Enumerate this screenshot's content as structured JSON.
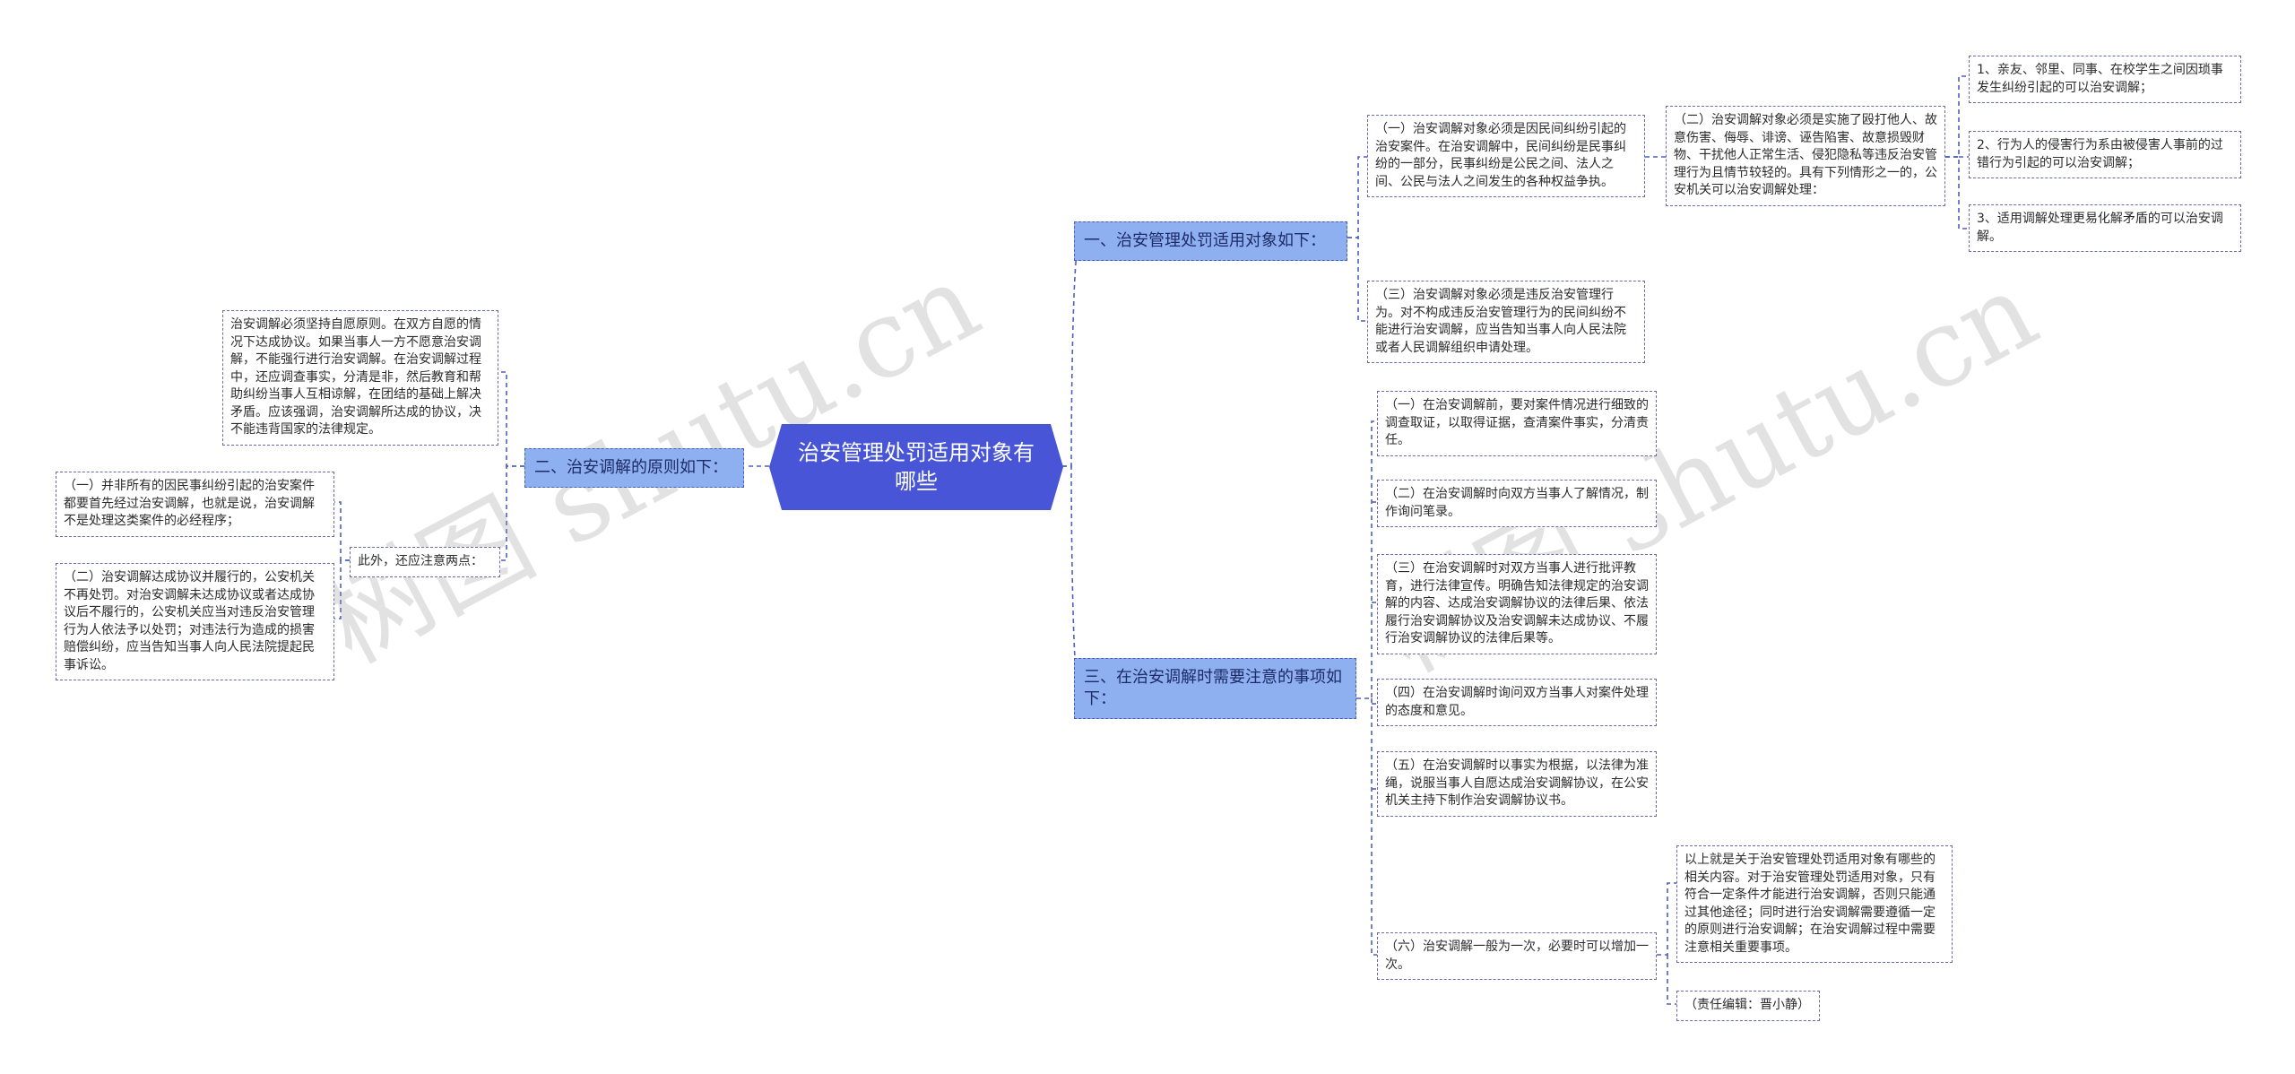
{
  "root": {
    "title": "治安管理处罚适用对象有哪些"
  },
  "branches": {
    "b1": "一、治安管理处罚适用对象如下：",
    "b2": "二、治安调解的原则如下：",
    "b3": "三、在治安调解时需要注意的事项如下："
  },
  "b1_children": {
    "c1": "（一）治安调解对象必须是因民间纠纷引起的治安案件。在治安调解中，民间纠纷是民事纠纷的一部分，民事纠纷是公民之间、法人之间、公民与法人之间发生的各种权益争执。",
    "c2": "（二）治安调解对象必须是实施了殴打他人、故意伤害、侮辱、诽谤、诬告陷害、故意损毁财物、干扰他人正常生活、侵犯隐私等违反治安管理行为且情节较轻的。具有下列情形之一的，公安机关可以治安调解处理：",
    "c3": "（三）治安调解对象必须是违反治安管理行为。对不构成违反治安管理行为的民间纠纷不能进行治安调解，应当告知当事人向人民法院或者人民调解组织申请处理。",
    "d1": "1、亲友、邻里、同事、在校学生之间因琐事发生纠纷引起的可以治安调解；",
    "d2": "2、行为人的侵害行为系由被侵害人事前的过错行为引起的可以治安调解；",
    "d3": "3、适用调解处理更易化解矛盾的可以治安调解。"
  },
  "b2_children": {
    "main": "治安调解必须坚持自愿原则。在双方自愿的情况下达成协议。如果当事人一方不愿意治安调解，不能强行进行治安调解。在治安调解过程中，还应调查事实，分清是非，然后教育和帮助纠纷当事人互相谅解，在团结的基础上解决矛盾。应该强调，治安调解所达成的协议，决不能违背国家的法律规定。",
    "extra": "此外，还应注意两点：",
    "p1": "（一）并非所有的因民事纠纷引起的治安案件都要首先经过治安调解，也就是说，治安调解不是处理这类案件的必经程序；",
    "p2": "（二）治安调解达成协议并履行的，公安机关不再处罚。对治安调解未达成协议或者达成协议后不履行的，公安机关应当对违反治安管理行为人依法予以处罚；对违法行为造成的损害赔偿纠纷，应当告知当事人向人民法院提起民事诉讼。"
  },
  "b3_children": {
    "e1": "（一）在治安调解前，要对案件情况进行细致的调查取证，以取得证据，查清案件事实，分清责任。",
    "e2": "（二）在治安调解时向双方当事人了解情况，制作询问笔录。",
    "e3": "（三）在治安调解时对双方当事人进行批评教育，进行法律宣传。明确告知法律规定的治安调解的内容、达成治安调解协议的法律后果、依法履行治安调解协议及治安调解未达成协议、不履行治安调解协议的法律后果等。",
    "e4": "（四）在治安调解时询问双方当事人对案件处理的态度和意见。",
    "e5": "（五）在治安调解时以事实为根据，以法律为准绳，说服当事人自愿达成治安调解协议，在公安机关主持下制作治安调解协议书。",
    "e6": "（六）治安调解一般为一次，必要时可以增加一次。",
    "f1": "以上就是关于治安管理处罚适用对象有哪些的相关内容。对于治安管理处罚适用对象，只有符合一定条件才能进行治安调解，否则只能通过其他途径；同时进行治安调解需要遵循一定的原则进行治安调解；在治安调解过程中需要注意相关重要事项。",
    "f2": "（责任编辑：晋小静）"
  },
  "watermarks": {
    "left": "树图 shutu.cn",
    "right": "树图 shutu.cn"
  }
}
